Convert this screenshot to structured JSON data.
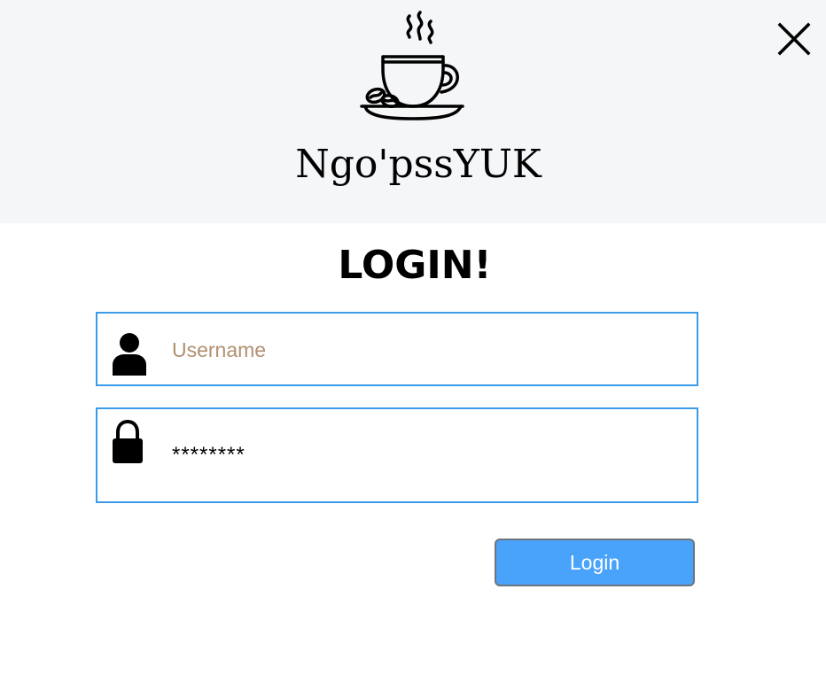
{
  "header": {
    "logo_icon": "coffee-cup-icon",
    "app_name": "Ngo'pssYUK",
    "close_icon": "close-icon"
  },
  "form": {
    "title": "LOGIN!",
    "username": {
      "icon": "user-icon",
      "placeholder": "Username",
      "value": ""
    },
    "password": {
      "icon": "lock-icon",
      "value": "********"
    },
    "login_label": "Login"
  },
  "colors": {
    "header_bg": "#f5f6f8",
    "field_border": "#3b9be8",
    "placeholder_text": "#b09070",
    "button_bg": "#4aa3fa",
    "button_border": "#6c757d"
  }
}
